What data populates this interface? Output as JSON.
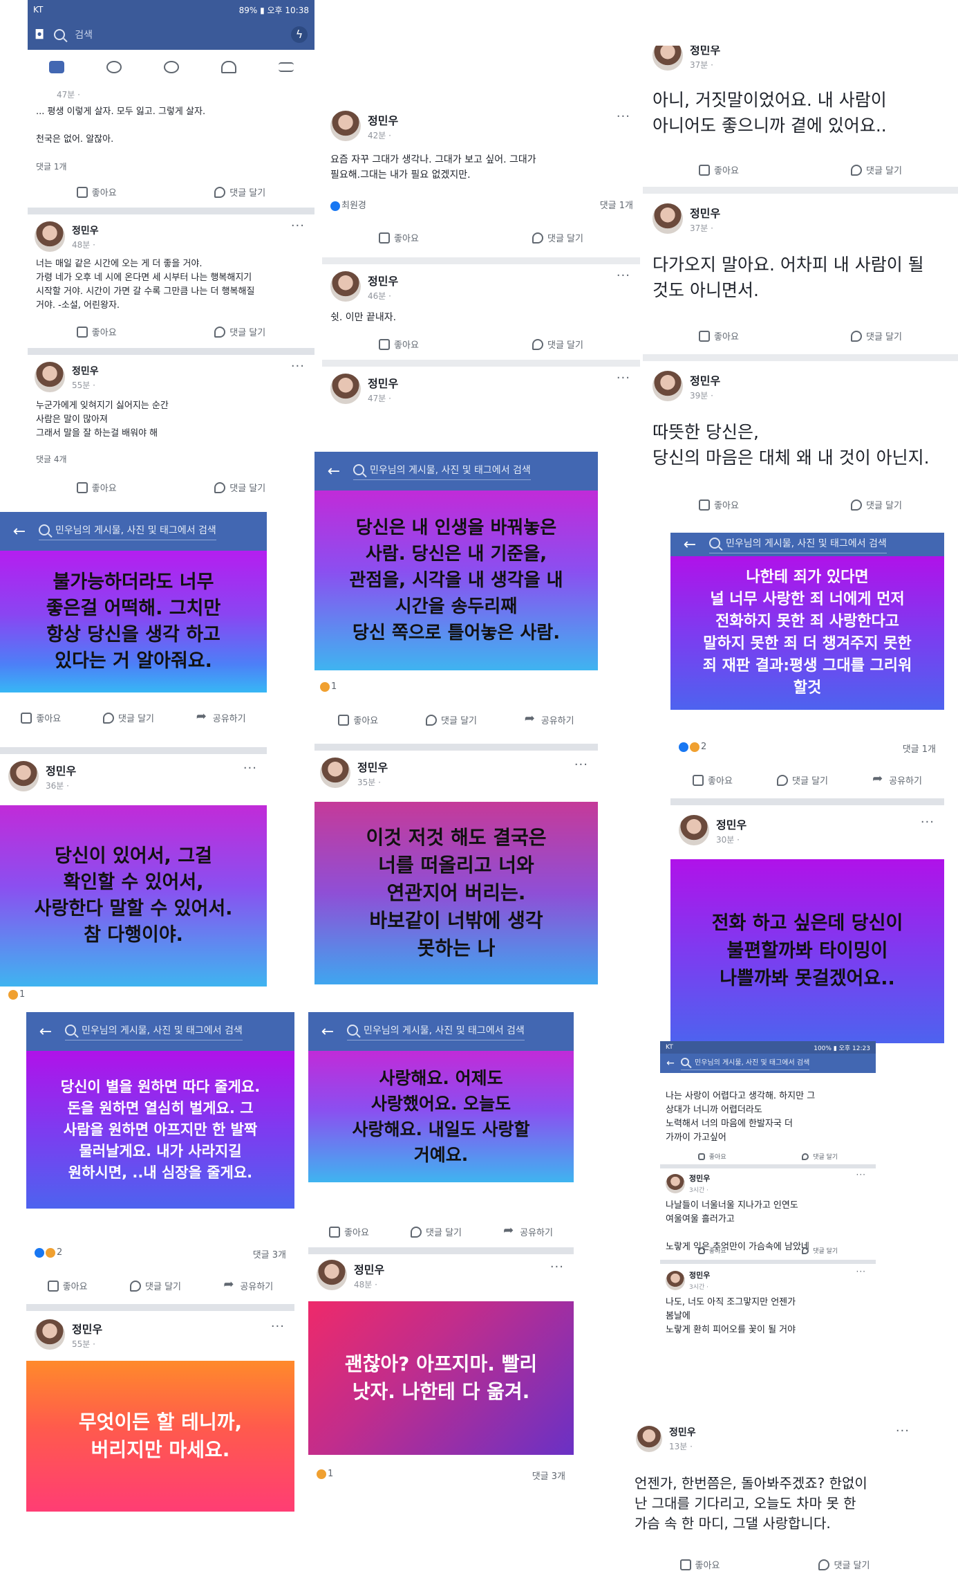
{
  "common": {
    "author": "정민우",
    "like": "좋아요",
    "comment": "댓글 달기",
    "share": "공유하기",
    "search_label": "민우님의 게시물, 사진 및 태그에서 검색"
  },
  "colA": {
    "status_left": "KT",
    "status_right": "89% ▮ 오후 10:38",
    "search_placeholder": "검색",
    "post1": {
      "time": "47분 · ",
      "text": "... 평생 이렇게 살자. 모두 잃고. 그렇게 살자.\n\n천국은 없어. 알잖아.",
      "comments": "댓글 1개"
    },
    "post2": {
      "time": "48분 · ",
      "text": "너는 매일 같은 시간에 오는 게 더 좋을 거야.\n가령 네가 오후 네 시에 온다면 세 시부터 나는 행복해지기\n시작할 거야. 시간이 가면 갈 수록 그만큼 나는 더 행복해질\n거야. -소설, 어린왕자."
    },
    "post3": {
      "time": "55분 · ",
      "text": "누군가에게 잊혀지기 싫어지는 순간\n 사람은 말이 많아져\n그래서 말을 잘 하는걸 배워야 해",
      "comments": "댓글 4개"
    }
  },
  "colB": {
    "post1": {
      "time": "42분 · ",
      "text": "요즘 자꾸 그대가 생각나. 그대가 보고 싶어. 그대가\n필요해.그대는 내가 필요 없겠지만.",
      "liker": "최원경",
      "comments": "댓글 1개"
    },
    "post2": {
      "time": "46분 · ",
      "text": "쉿. 이만 끝내자."
    },
    "post3": {
      "time": "47분 · "
    }
  },
  "colC": {
    "post0": {
      "time": "37분 · ",
      "text": "아니, 거짓말이었어요. 내 사람이\n아니어도 좋으니까 곁에 있어요.."
    },
    "post1": {
      "time": "37분 · ",
      "text": "다가오지 말아요. 어차피 내 사람이 될\n것도 아니면서."
    },
    "post2": {
      "time": "39분 · ",
      "text": "따뜻한 당신은,\n당신의 마음은 대체 왜 내 것이 아닌지."
    }
  },
  "g1": {
    "text": "불가능하더라도 너무\n좋은걸 어떡해. 그치만\n항상 당신을 생각 하고\n있다는 거 알아줘요.",
    "time": "36분 · ",
    "next": "당신이 있어서, 그걸\n확인할 수 있어서,\n사랑한다 말할 수 있어서.\n참 다행이야.",
    "count": "1"
  },
  "g2": {
    "text": "당신은 내 인생을 바꿔놓은\n사람. 당신은 내 기준을,\n관점을, 시각을 내 생각을 내\n시간을 송두리째\n당신 쪽으로 틀어놓은 사람.",
    "reactions": "1",
    "time": "35분 · ",
    "next": "이것 저것 해도 결국은\n너를 떠올리고 너와\n연관지어 버리는.\n바보같이 너밖에 생각\n못하는 나"
  },
  "g3": {
    "text": "나한테 죄가 있다면\n널 너무 사랑한 죄 너에게 먼저\n전화하지 못한 죄 사랑한다고\n말하지 못한 죄  더 챙겨주지 못한\n죄  재판 결과:평생 그대를 그리워\n할것",
    "reactions": "2",
    "comments": "댓글 1개",
    "time": "30분 · ",
    "next": "전화 하고 싶은데 당신이\n불편할까봐 타이밍이\n나쁠까봐 못걸겠어요.."
  },
  "g4": {
    "text": "당신이 별을 원하면 따다 줄게요.\n돈을 원하면 열심히 벌게요. 그\n사람을 원하면 아프지만 한 발짝\n물러날게요. 내가 사라지길\n원하시면, ..내 심장을 줄게요.",
    "reactions": "2",
    "comments": "댓글 3개",
    "time": "55분 · ",
    "next": "무엇이든 할 테니까,\n버리지만 마세요."
  },
  "g5": {
    "text": "사랑해요. 어제도\n사랑했어요. 오늘도\n사랑해요. 내일도 사랑할\n거예요.",
    "time": "48분 · ",
    "next": "괜찮아? 아프지마. 빨리\n낫자. 나한테 다 옮겨.",
    "reactions": "1",
    "comments": "댓글 3개"
  },
  "colE": {
    "status_left": "KT",
    "status_right": "100% ▮ 오후 12:23",
    "post0": {
      "text": "나는 사랑이 어렵다고 생각해. 하지만 그\n상대가 너니까 어렵더라도\n노력해서 너의 마음에 한발자국 더\n가까이 가고싶어"
    },
    "post1": {
      "time": "3시간 · ",
      "text": "나날들이 너울너울 지나가고 인연도\n여울여울 흘러가고\n\n노랗게 익은 추억만이 가슴속에 남았네"
    },
    "post2": {
      "time": "3시간 · ",
      "text": "나도, 너도 아직 조그맣지만 언젠가\n봄날에\n노랗게 환히 피어오를 꽃이 될 거야"
    }
  },
  "colF": {
    "time": "13분 · ",
    "text": "언젠가, 한번쯤은, 돌아봐주겠죠? 한없이\n난 그대를 기다리고, 오늘도 차마 못 한\n가슴 속 한 마디, 그댈 사랑합니다."
  }
}
